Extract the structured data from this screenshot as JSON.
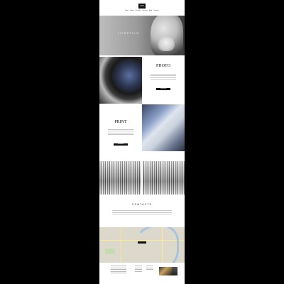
{
  "header": {
    "logo_text": "505",
    "nav_items": [
      "Home",
      "About",
      "Portfolio",
      "Services",
      "Blog",
      "Contacts"
    ],
    "sub_items": [
      "",
      "",
      "",
      ""
    ]
  },
  "hero": {
    "title": "LIFESTYLE"
  },
  "sections": [
    {
      "heading": "PHOTO",
      "button": "Read more"
    },
    {
      "heading": "PRINT",
      "button": "Read more"
    }
  ],
  "contacts": {
    "title": "CONTACTS"
  },
  "map": {
    "pin_label": ""
  },
  "footer": {
    "column_titles": [
      "",
      "",
      ""
    ]
  }
}
